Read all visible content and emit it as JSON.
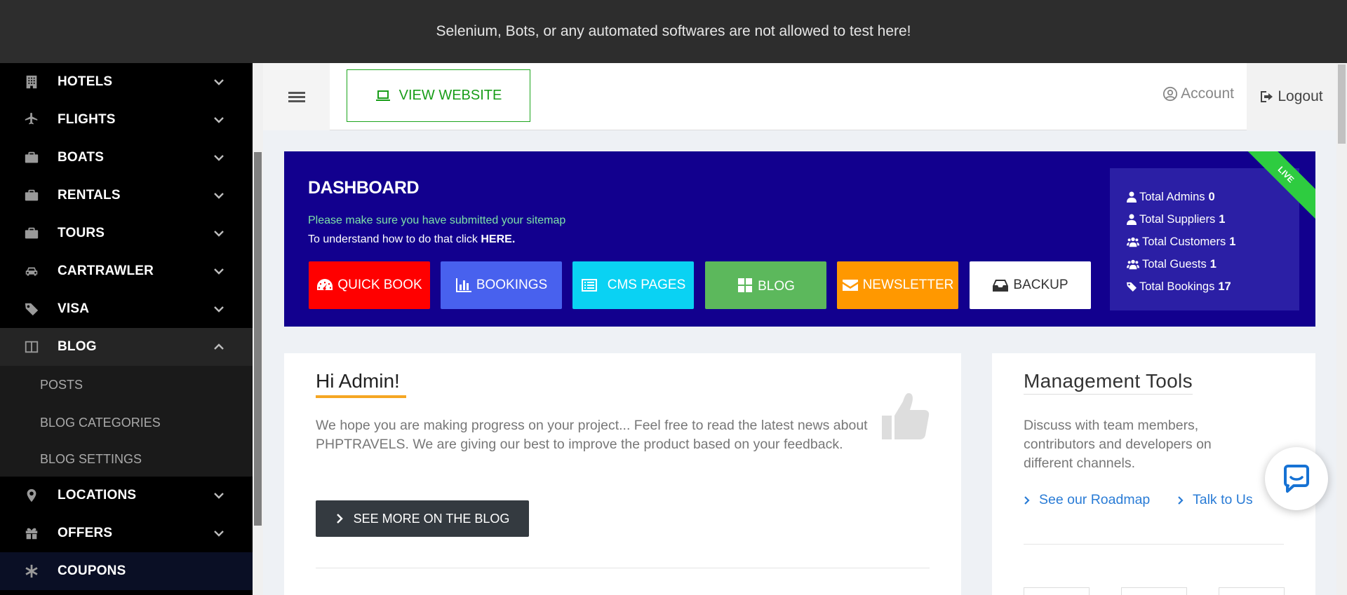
{
  "banner": {
    "text": "Selenium, Bots, or any automated softwares are not allowed to test here!"
  },
  "sidebar": {
    "items": [
      {
        "label": "HOTELS",
        "icon": "building-icon"
      },
      {
        "label": "FLIGHTS",
        "icon": "plane-icon"
      },
      {
        "label": "BOATS",
        "icon": "briefcase-icon"
      },
      {
        "label": "RENTALS",
        "icon": "briefcase-icon"
      },
      {
        "label": "TOURS",
        "icon": "briefcase-icon"
      },
      {
        "label": "CARTRAWLER",
        "icon": "car-icon"
      },
      {
        "label": "VISA",
        "icon": "tag-icon"
      },
      {
        "label": "BLOG",
        "icon": "columns-icon",
        "expanded": true,
        "children": [
          "POSTS",
          "BLOG CATEGORIES",
          "BLOG SETTINGS"
        ]
      },
      {
        "label": "LOCATIONS",
        "icon": "map-pin-icon"
      },
      {
        "label": "OFFERS",
        "icon": "gift-icon"
      },
      {
        "label": "COUPONS",
        "icon": "asterisk-icon"
      }
    ]
  },
  "header": {
    "view_website": "VIEW WEBSITE",
    "account": "Account",
    "logout": "Logout"
  },
  "dashboard": {
    "title": "DASHBOARD",
    "sitemap_note": "Please make sure you have submitted your sitemap",
    "howto_prefix": "To understand how to do that click ",
    "howto_link": "HERE.",
    "ribbon": "LIVE",
    "buttons": {
      "quick_book": "QUICK BOOK",
      "bookings": "BOOKINGS",
      "cms_pages": "CMS PAGES",
      "blog": "BLOG",
      "newsletter": "NEWSLETTER",
      "backup": "BACKUP"
    },
    "stats": [
      {
        "label": "Total Admins",
        "value": "0"
      },
      {
        "label": "Total Suppliers",
        "value": "1"
      },
      {
        "label": "Total Customers",
        "value": "1"
      },
      {
        "label": "Total Guests",
        "value": "1"
      },
      {
        "label": "Total Bookings",
        "value": "17"
      }
    ]
  },
  "welcome": {
    "title": "Hi Admin!",
    "text": "We hope you are making progress on your project... Feel free to read the latest news about PHPTRAVELS. We are giving our best to improve the product based on your feedback.",
    "button": "SEE MORE ON THE BLOG"
  },
  "management": {
    "title": "Management Tools",
    "text": "Discuss with team members, contributors and developers on different channels.",
    "links": [
      "See our Roadmap",
      "Talk to Us"
    ]
  },
  "colors": {
    "dashboard_bg": "#12008e",
    "quick_book": "#ff0000",
    "bookings": "#4861ee",
    "cms_pages": "#0ad2f3",
    "blog": "#5cb85c",
    "newsletter": "#ff9800",
    "accent_underline": "#f5a623",
    "link": "#2a7cd6"
  }
}
